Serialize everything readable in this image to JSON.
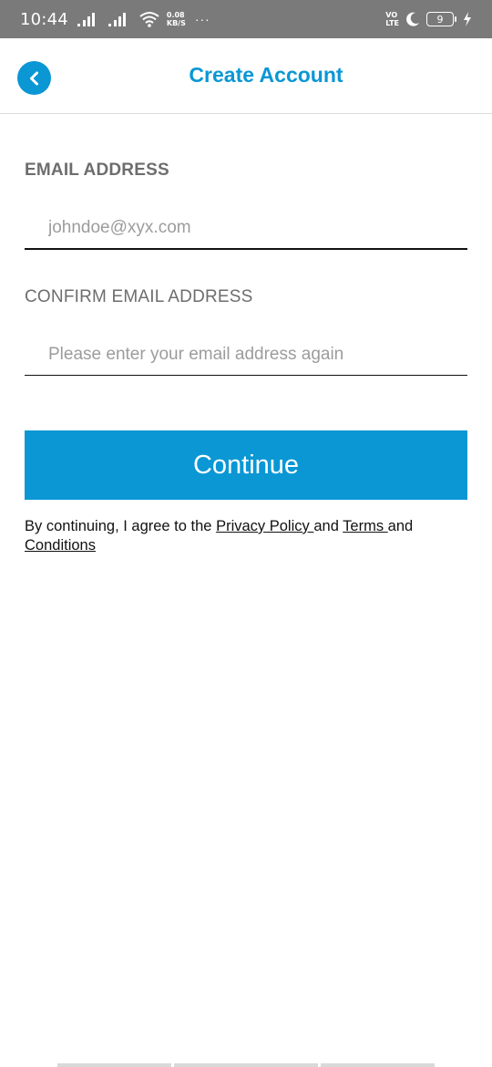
{
  "status_bar": {
    "time": "10:44",
    "net_speed_value": "0.08",
    "net_speed_unit": "KB/S",
    "more": "···",
    "volte_top": "VO",
    "volte_bottom": "LTE",
    "battery_level": "9",
    "icons": [
      "signal-icon",
      "signal-icon",
      "wifi-icon",
      "moon-icon",
      "battery-icon",
      "charging-icon"
    ]
  },
  "header": {
    "title": "Create Account",
    "back_icon": "chevron-left-icon"
  },
  "form": {
    "email_label": "EMAIL ADDRESS",
    "email_placeholder": "johndoe@xyx.com",
    "confirm_label": "CONFIRM EMAIL ADDRESS",
    "confirm_placeholder": "Please enter your email address again",
    "continue_label": "Continue"
  },
  "legal": {
    "prefix": "By continuing, I agree to the ",
    "privacy_link": "Privacy Policy ",
    "middle": "and ",
    "terms_link": "Terms ",
    "suffix": "and",
    "conditions_link": "Conditions"
  },
  "colors": {
    "accent": "#0a97d4",
    "status_bar": "#7a7a7a",
    "label_gray": "#6d6d6d",
    "placeholder_gray": "#9c9c9c"
  }
}
